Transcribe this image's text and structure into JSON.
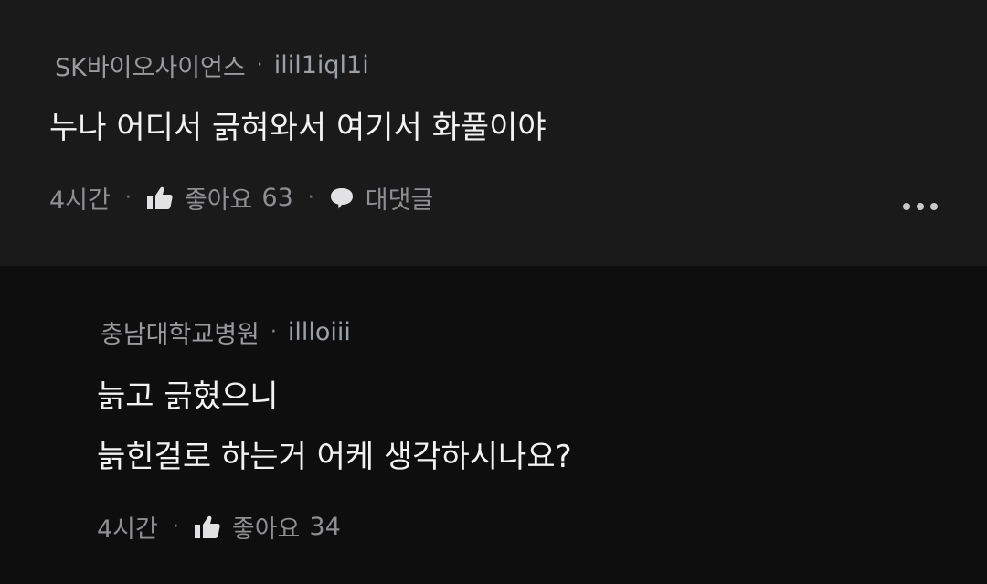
{
  "comment": {
    "organization": "SK바이오사이언스",
    "username": "ilil1iql1i",
    "text": "누나 어디서 긁혀와서 여기서 화풀이야",
    "time": "4시간",
    "like_label": "좋아요",
    "like_count": "63",
    "reply_label": "대댓글"
  },
  "reply": {
    "organization": "충남대학교병원",
    "username": "illloiii",
    "lines": [
      "늙고 긁혔으니",
      "늙힌걸로 하는거 어케 생각하시나요?"
    ],
    "time": "4시간",
    "like_label": "좋아요",
    "like_count": "34"
  },
  "separator": "·"
}
